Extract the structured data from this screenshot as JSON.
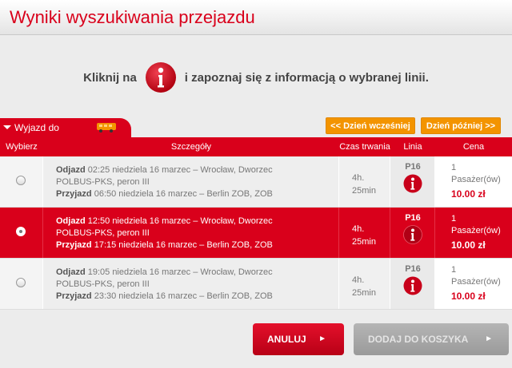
{
  "header": {
    "title": "Wyniki wyszukiwania przejazdu"
  },
  "info": {
    "before": "Kliknij na",
    "after": "i zapoznaj się z informacją o wybranej linii."
  },
  "tab": {
    "label": "Wyjazd do"
  },
  "nav": {
    "prev": "<< Dzień wcześniej",
    "next": "Dzień później >>"
  },
  "columns": {
    "select": "Wybierz",
    "details": "Szczegóły",
    "duration": "Czas trwania",
    "line": "Linia",
    "price": "Cena"
  },
  "rows": [
    {
      "selected": false,
      "dep_label": "Odjazd",
      "dep_text": "02:25 niedziela 16 marzec – Wrocław, Dworzec POLBUS-PKS, peron III",
      "arr_label": "Przyjazd",
      "arr_text": "06:50 niedziela 16 marzec – Berlin ZOB, ZOB",
      "dur_h": "4h.",
      "dur_m": "25min",
      "line": "P16",
      "pax_count": "1",
      "pax_label": "Pasażer(ów)",
      "price": "10.00 zł"
    },
    {
      "selected": true,
      "dep_label": "Odjazd",
      "dep_text": "12:50 niedziela 16 marzec – Wrocław, Dworzec POLBUS-PKS, peron III",
      "arr_label": "Przyjazd",
      "arr_text": "17:15 niedziela 16 marzec – Berlin ZOB, ZOB",
      "dur_h": "4h.",
      "dur_m": "25min",
      "line": "P16",
      "pax_count": "1",
      "pax_label": "Pasażer(ów)",
      "price": "10.00 zł"
    },
    {
      "selected": false,
      "dep_label": "Odjazd",
      "dep_text": "19:05 niedziela 16 marzec – Wrocław, Dworzec POLBUS-PKS, peron III",
      "arr_label": "Przyjazd",
      "arr_text": "23:30 niedziela 16 marzec – Berlin ZOB, ZOB",
      "dur_h": "4h.",
      "dur_m": "25min",
      "line": "P16",
      "pax_count": "1",
      "pax_label": "Pasażer(ów)",
      "price": "10.00 zł"
    }
  ],
  "buttons": {
    "cancel": "ANULUJ",
    "add": "DODAJ DO KOSZYKA"
  },
  "icons": {
    "info": "info-icon",
    "bus": "bus-icon",
    "chevron": "chevron-right-icon",
    "tab_arrow": "caret-down-icon"
  },
  "colors": {
    "accent": "#d9001b",
    "nav": "#f39400",
    "disabled": "#a8a8a8"
  }
}
